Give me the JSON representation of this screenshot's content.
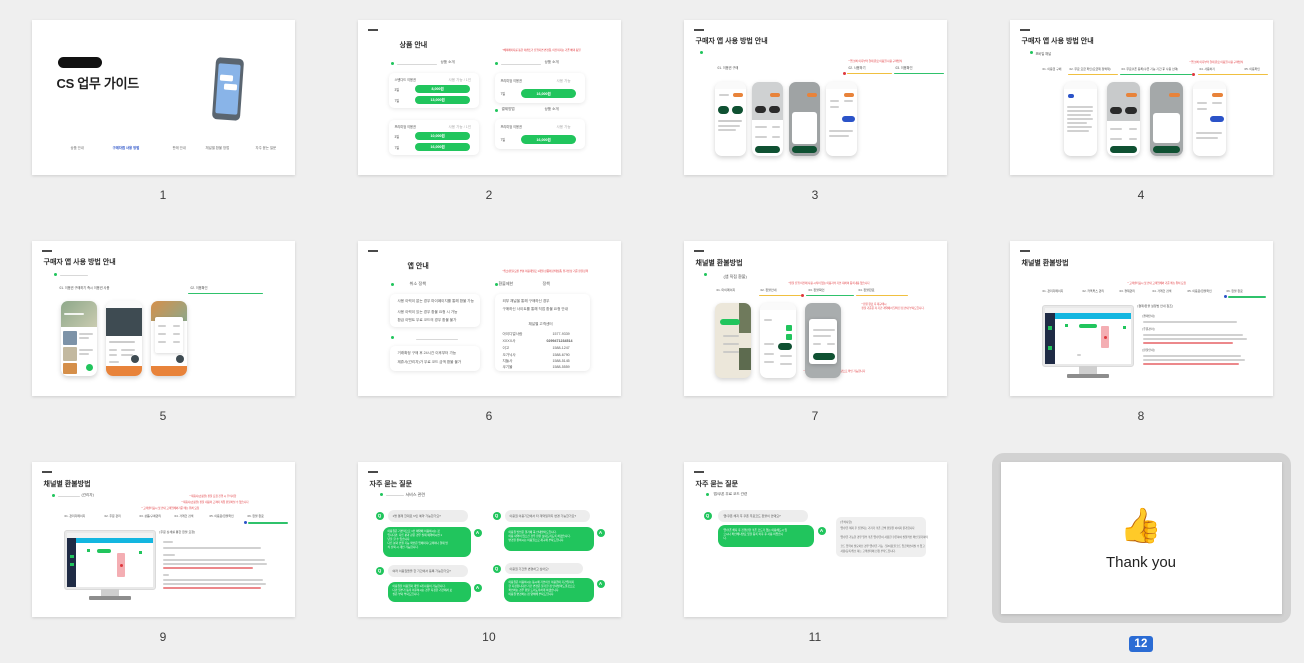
{
  "app": {
    "view": "slide-grid",
    "background_color": "#efefef",
    "selected_slide": 12,
    "total_slides": 12,
    "selection_badge_color": "#2b6cd4",
    "selection_border_color": "#d2d2d2"
  },
  "slides": [
    {
      "number": "1",
      "kind": "title",
      "title": "CS 업무 가이드",
      "redacted_logo": true,
      "nav_items": [
        "상품 안내",
        "구매자앱 사용 방법",
        "판매 안내",
        "채널별 환불 방법",
        "자주 묻는 질문"
      ],
      "nav_active_index": 1
    },
    {
      "number": "2",
      "kind": "content",
      "title": "상품 안내",
      "section_left": "상품 소개",
      "section_right": "상품 소개",
      "section_right2_label": "결제방법",
      "section_right2": "상품 소개",
      "red_note": "*혜택페이지를 통한 이벤트가 진행되면 변경됨, 이전까지는 기존 혜택 동일",
      "cards": [
        {
          "name": "스탠다드 이용권",
          "badge": "사용 가능 / 1인",
          "rows": [
            {
              "term": "3일",
              "price": "8,000원"
            },
            {
              "term": "7일",
              "price": "13,000원"
            }
          ]
        },
        {
          "name": "프리미엄 이용권",
          "badge": "사용 가능 / 1인",
          "rows": [
            {
              "term": "3일",
              "price": "10,000원"
            },
            {
              "term": "7일",
              "price": "16,000원"
            }
          ]
        },
        {
          "name": "프리미엄 이용권",
          "badge": "사용 가능",
          "rows": [
            {
              "term": "7일",
              "price": "16,000원"
            }
          ]
        },
        {
          "name": "프리미엄 이용권",
          "badge": "사용 가능",
          "rows": [
            {
              "term": "7일",
              "price": "16,000원"
            }
          ]
        }
      ]
    },
    {
      "number": "3",
      "kind": "content",
      "title": "구매자 앱 사용 방법 안내",
      "subtitle": "01. 이용권 구매",
      "red_note": "* 앱 설치 이후부터 결제 완료 이용권 사용 구매방식",
      "steps": [
        "02. 사용하기",
        "03. 이용확인"
      ],
      "rule_colors": [
        "#f0c040",
        "#2fc26b"
      ]
    },
    {
      "number": "4",
      "kind": "content",
      "title": "구매자 앱 사용 방법 안내",
      "subtitle": "모바일 채널",
      "red_note": "* 앱 설치 이후부터 결제 완료 이용권 사용 구매방식",
      "steps": [
        "01. 이용권 구매",
        "02. 무료 요금 확인(요금제 정액제)",
        "03. 무료쿠폰 등록(쿠폰 기능 기간 후 사용 선택)",
        "04. 사용하기",
        "05. 이용확인"
      ],
      "rule_colors": [
        "#f0c040",
        "#2fc26b",
        "#f0c040"
      ]
    },
    {
      "number": "5",
      "kind": "content",
      "title": "구매자 앱 사용 방법 안내",
      "subtitle": "01. 이용권 구매하기 즉시 이용권 사용",
      "steps": [
        "02. 이용확인"
      ],
      "rule_colors": [
        "#2fc26b"
      ]
    },
    {
      "number": "6",
      "kind": "content",
      "title": "앱 안내",
      "section_left": "취소 정책",
      "section_right_label": "환불제한",
      "section_right": "정책",
      "red_note": "*취소/환불/교환 부분 이용개월로 1개월 상품에 판매상품, 취자인상 기준 환불정책",
      "left_bullets": [
        "사용 이력이 없는 경우 마이페이지를 통해 환불 가능",
        "사용 이력이 있는 경우 환불 요청 시 가능",
        "환급 이벤트 무료 코드의 경우 환불 불가"
      ],
      "left_bullets2": [
        "거래확정 구매 후 24시간 이후부터 가능",
        "제휴사(관리자)가 무료 코드 금액 환불 불가"
      ],
      "right_bullets": [
        "외부 채널을 통해 구매하신 경우",
        "구매하신 사이트를 통해 직접 환불 요청 안내"
      ],
      "right_table_title": "채널별 고객센터",
      "right_table": [
        {
          "name": "아이디얼사람",
          "value": "1577-9339"
        },
        {
          "name": "XXXX사",
          "value": "0299471234514"
        },
        {
          "name": "이고",
          "value": "1588-1247"
        },
        {
          "name": "오가닉사",
          "value": "1588-6790"
        },
        {
          "name": "지들사",
          "value": "1588-5145"
        },
        {
          "name": "쿠기몰",
          "value": "1588-5559"
        }
      ]
    },
    {
      "number": "7",
      "kind": "content",
      "title": "채널별 환불방법",
      "subtitle": "(앱 직접 환불)",
      "steps": [
        "01. 마이페이지",
        "02. 환불안내",
        "03. 환불확인",
        "04. 환불완료"
      ],
      "red_note_top": "*환불 진행 이전에 사용 시작이 없는 이용자의 기본 대하여 등록내용 없습니다",
      "red_note_right": "* 환불 완료 후 재구매시\n환불 기준은 각 기간 계약에서 달라진 점 안내 부탁드립니다.",
      "red_note_bottom": "* 환불신청하더라도 지정된 결제 수량으로 확인 가능합니다",
      "rule_colors": [
        "#f0c040",
        "#2fc26b",
        "#f0c040"
      ]
    },
    {
      "number": "8",
      "kind": "content",
      "title": "채널별 환불방법",
      "red_note": "* 고객센터표시 및 안내 고객업체와 기준 메뉴 위치 요청",
      "steps": [
        "01. 관리자페이지",
        "02. 카톡톡스 관리",
        "03. 결제관리",
        "04. 거래건 검색",
        "05. 이용료/환불확인",
        "06. 환불 완료"
      ],
      "body_title": "[결제/환불 설정법 안내 참조]",
      "body_sections": [
        "[결제안내]",
        "[주문관리]",
        "[환불안내]"
      ],
      "rule_colors": [
        "#2fc26b"
      ]
    },
    {
      "number": "9",
      "kind": "content",
      "title": "채널별 환불방법",
      "subtitle": "(관리자)",
      "red_note_1": "* 제휴사(쇼핑몰) 환불 요청 진행 시 주의사항",
      "red_note_2": "* 제휴사(쇼핑몰) 환불 내용이 고객이 직접 환불하실 수 없습니다",
      "red_note_3": "* 고객센터표시 및 안내 고객업체와기준 메뉴 위치 요청",
      "steps": [
        "01. 관리자페이지",
        "02. 주문 관리",
        "03. 상품/구매관리",
        "04. 거래건 검색",
        "05. 이용료/환불확인",
        "06. 환불 완료"
      ],
      "body_title": "[주문 상세를 통한 환불 요청]",
      "rule_colors": [
        "#2fc26b"
      ]
    },
    {
      "number": "10",
      "kind": "faq",
      "title": "자주 묻는 질문",
      "subtitle": "서비스 관련",
      "qa": [
        {
          "q": "1명 결제 한대로 N인 예약 가능한가요?",
          "a": "이용권은 기본적으로 1인 예약에 이용하시는 것\n입니다만, 다른 분과 같은 경우 실제 예약하시면 1\n년을 할 수 있습니다.\n다른 분과 인원 기능 확인은 업체마다/고객이나 결제 방\n식 선택 시 개인 가능합니다."
        },
        {
          "q": "이용권 이용기간에서 타 계약일까지 변경 가능한가요?",
          "a": "이용권 방법은 결기에 꼭 안내받아드립니다.\n이용 내역이 없으신 경우 환불 보내드리도록 하겠습니다.\n변경을 원하시는 이용권으로 재구매 부탁드립니다."
        },
        {
          "q": "여러 이용권들을 한 기간에서 동록 가능한가요?",
          "a": "이용권을 이용권과 개별 1개 사용이 가능합니다.\n다만 일부가 동록 이후하시는 경우 지정한 기간에서 보\n실은 부탁 부탁드립니다."
        },
        {
          "q": "이용권 기간을 변경하고 싶어요!",
          "a": "이용권은 이용하시는 동시에 기본이신 이용권이 기간일까지\n한 지정합니다만 기간 변경은 불가한 점 안내받아드릴것으로\n확인하는 경우 환불 드리도록하게 하겠습니다.\n이용권 변경하는 점 양해해 부탁드립니다."
        }
      ]
    },
    {
      "number": "11",
      "kind": "faq",
      "title": "자주 묻는 질문",
      "subtitle": "앱/쿠폰 무료 코드 관련",
      "qa": [
        {
          "q": "앱/쿠폰 해지 후 쿠폰 무료코드 환불이 안돼요?",
          "a": "앱/쿠폰 해지 후 진행만한 쿠폰 코드가 없는 이용해드시 있\n으시나 확인해니면요 있을 등록 이후 후 사용 어렵습니\n다."
        }
      ],
      "note_title": "[주의사항]",
      "note_lines": [
        "앱/쿠폰 해지 후 진행되는 기기가 쿠폰 금액 환불을 이어지 불가합니다",
        "앱/쿠폰 가능한 경우 일부 쿠폰 앱/쿠폰이 사용한 쿠폰하여 실질적인 확인 불가하며",
        "코드 입력이 필요하신 경우 앱/쿠폰 기능 · 일/이용권 코드 입금확인하실 수 있고",
        "사용/등록/취소 하는 고객센터에 신청 부탁드립니다."
      ]
    },
    {
      "number": "12",
      "kind": "thankyou",
      "text": "Thank you",
      "icon": "thumbs-up-hand",
      "selected": true
    }
  ]
}
